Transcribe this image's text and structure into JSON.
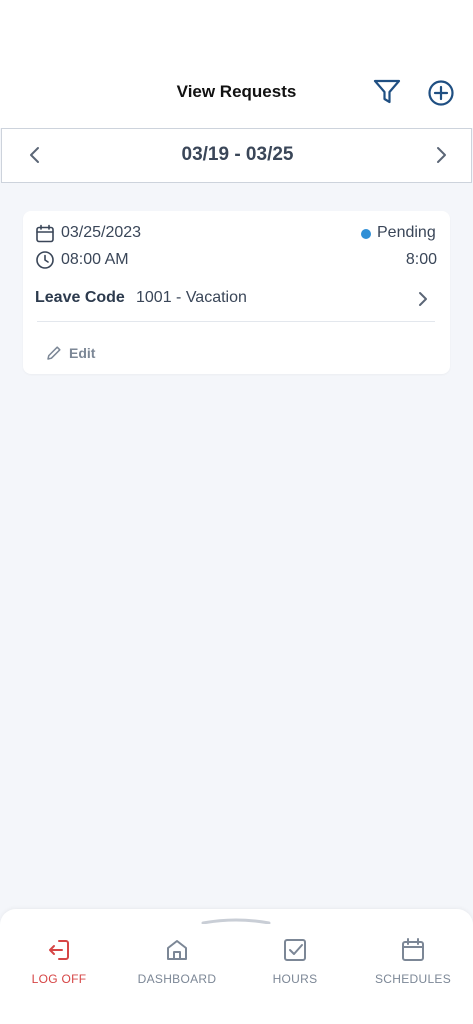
{
  "header": {
    "title": "View Requests",
    "filter_icon": "filter-icon",
    "add_icon": "plus-circle-icon"
  },
  "week": {
    "label": "03/19 - 03/25",
    "prev_icon": "chevron-left-icon",
    "next_icon": "chevron-right-icon"
  },
  "requests": [
    {
      "date": "03/25/2023",
      "time": "08:00 AM",
      "status": "Pending",
      "status_color": "#2f8fd6",
      "hours": "8:00",
      "leave_code_label": "Leave Code",
      "leave_code_value": "1001 - Vacation",
      "edit_label": "Edit"
    }
  ],
  "bottom_nav": {
    "items": [
      {
        "label": "LOG OFF",
        "icon": "log-off-icon",
        "color": "#d64545"
      },
      {
        "label": "DASHBOARD",
        "icon": "home-icon",
        "color": "#7c8796"
      },
      {
        "label": "HOURS",
        "icon": "checkbox-icon",
        "color": "#7c8796"
      },
      {
        "label": "SCHEDULES",
        "icon": "calendar-icon",
        "color": "#7c8796"
      }
    ]
  },
  "colors": {
    "accent": "#1f4f82",
    "background": "#f4f6fa",
    "logoff": "#d64545"
  }
}
